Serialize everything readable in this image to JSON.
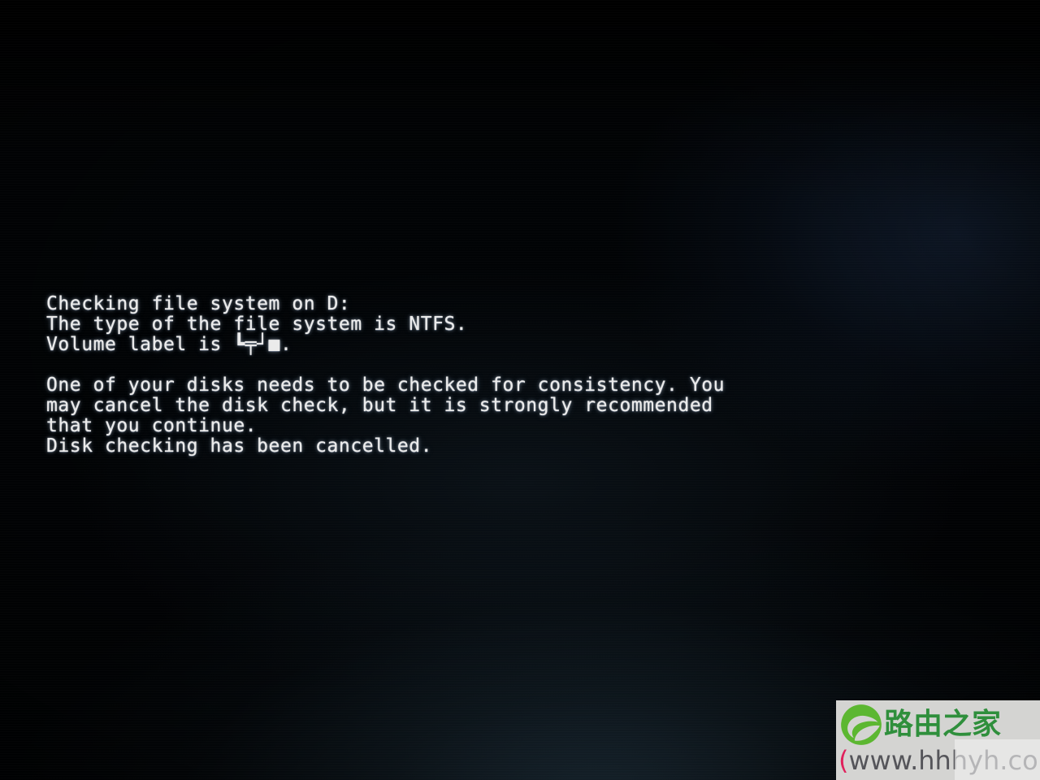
{
  "screen": {
    "background_color": "#010305",
    "glow_color": "#2c4658",
    "text_color": "#ebebeb"
  },
  "console": {
    "lines": [
      {
        "text": "Checking file system on D:",
        "blank": false
      },
      {
        "text": "The type of the file system is NTFS.",
        "blank": false
      },
      {
        "text": "Volume label is ┗╤┘■.",
        "blank": false
      },
      {
        "text": "",
        "blank": true
      },
      {
        "text": "One of your disks needs to be checked for consistency. You",
        "blank": false
      },
      {
        "text": "may cancel the disk check, but it is strongly recommended",
        "blank": false
      },
      {
        "text": "that you continue.",
        "blank": false
      },
      {
        "text": "Disk checking has been cancelled.",
        "blank": false
      }
    ]
  },
  "watermark": {
    "site_name_cn": "路由之家",
    "url_open_paren": "(",
    "url_text": "www.hhhyh.com",
    "url_close_paren": ")",
    "brand_green": "#2f8f3c",
    "logo_green": "#5cb731",
    "paren_pink": "#e0215c",
    "panel_color": "#d4d4d2"
  }
}
